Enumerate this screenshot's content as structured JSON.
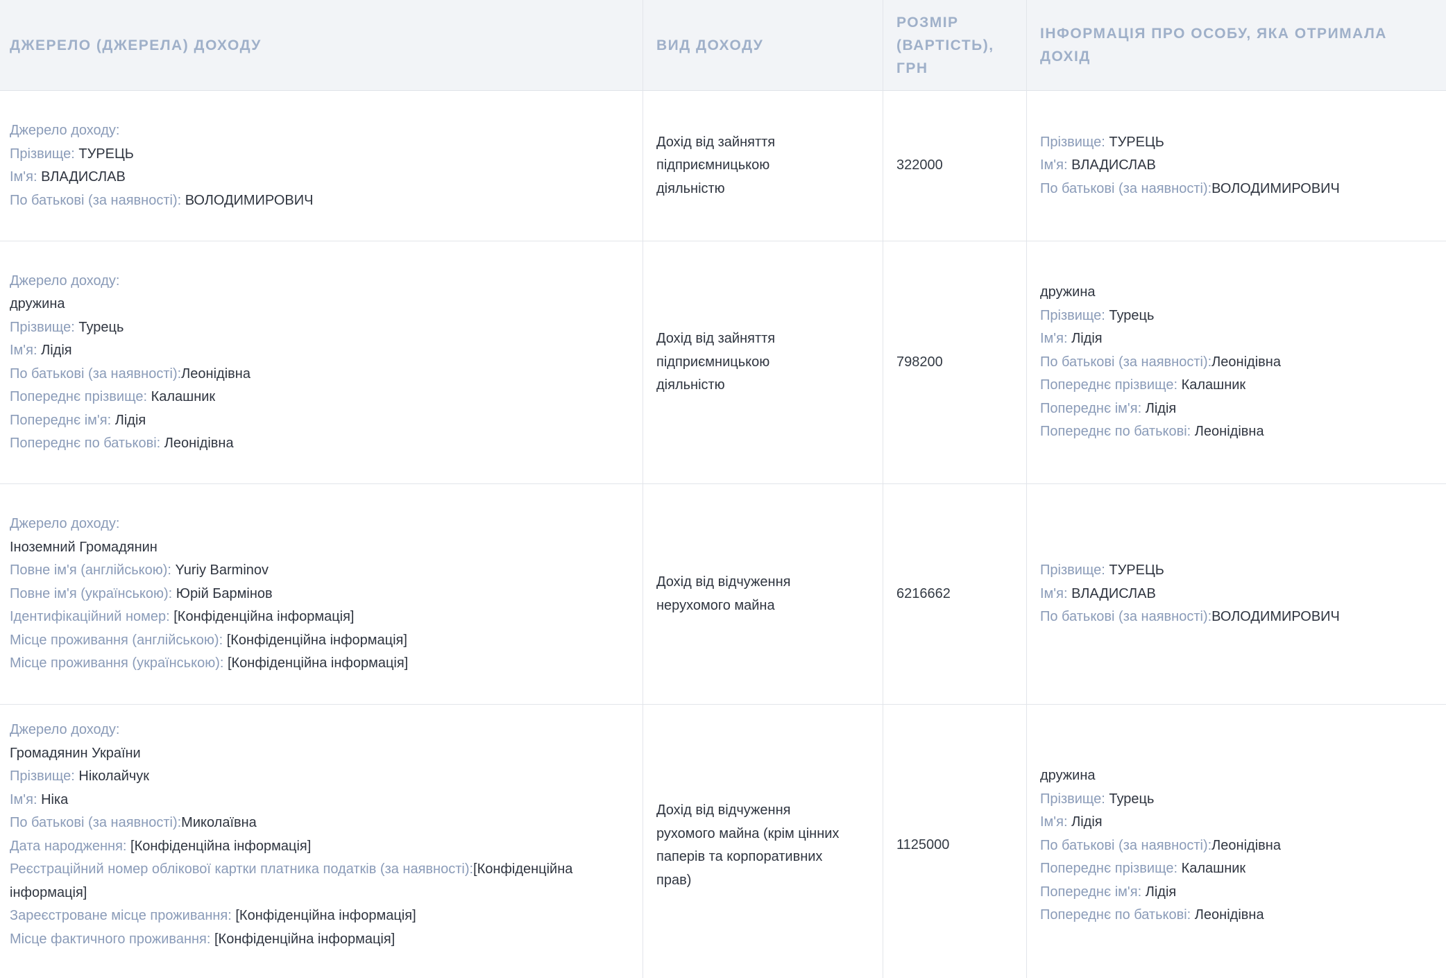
{
  "header": {
    "source": "ДЖЕРЕЛО (ДЖЕРЕЛА) ДОХОДУ",
    "type": "ВИД ДОХОДУ",
    "amount": "РОЗМІР (ВАРТІСТЬ), ГРН",
    "recipient": "ІНФОРМАЦІЯ ПРО ОСОБУ, ЯКА ОТРИМАЛА ДОХІД"
  },
  "rows": [
    {
      "source": [
        {
          "label": "Джерело доходу:",
          "value": ""
        },
        {
          "label": "Прізвище: ",
          "value": "ТУРЕЦЬ"
        },
        {
          "label": "Ім'я: ",
          "value": "ВЛАДИСЛАВ"
        },
        {
          "label": "По батькові (за наявності): ",
          "value": "ВОЛОДИМИРОВИЧ"
        }
      ],
      "type": [
        "Дохід від зайняття",
        "підприємницькою",
        "діяльністю"
      ],
      "amount": "322000",
      "recipient": [
        {
          "label": "Прізвище: ",
          "value": "ТУРЕЦЬ"
        },
        {
          "label": "Ім'я: ",
          "value": "ВЛАДИСЛАВ"
        },
        {
          "label": "По батькові (за наявності):",
          "value": "ВОЛОДИМИРОВИЧ"
        }
      ]
    },
    {
      "source": [
        {
          "label": "Джерело доходу:",
          "value": ""
        },
        {
          "label": "",
          "value": "дружина"
        },
        {
          "label": "Прізвище: ",
          "value": "Турець"
        },
        {
          "label": "Ім'я: ",
          "value": "Лідія"
        },
        {
          "label": "По батькові (за наявності):",
          "value": "Леонідівна"
        },
        {
          "label": "Попереднє прізвище: ",
          "value": "Калашник"
        },
        {
          "label": "Попереднє ім'я: ",
          "value": "Лідія"
        },
        {
          "label": "Попереднє по батькові: ",
          "value": "Леонідівна"
        }
      ],
      "type": [
        "Дохід від зайняття",
        "підприємницькою",
        "діяльністю"
      ],
      "amount": "798200",
      "recipient": [
        {
          "label": "",
          "value": "дружина"
        },
        {
          "label": "Прізвище: ",
          "value": "Турець"
        },
        {
          "label": "Ім'я: ",
          "value": "Лідія"
        },
        {
          "label": "По батькові (за наявності):",
          "value": "Леонідівна"
        },
        {
          "label": "Попереднє прізвище: ",
          "value": "Калашник"
        },
        {
          "label": "Попереднє ім'я: ",
          "value": "Лідія"
        },
        {
          "label": "Попереднє по батькові: ",
          "value": "Леонідівна"
        }
      ]
    },
    {
      "source": [
        {
          "label": "Джерело доходу:",
          "value": ""
        },
        {
          "label": "",
          "value": "Іноземний Громадянин"
        },
        {
          "label": "Повне ім'я (англійською): ",
          "value": "Yuriy Barminov"
        },
        {
          "label": "Повне ім'я (українською): ",
          "value": "Юрій Бармінов"
        },
        {
          "label": "Ідентифікаційний номер: ",
          "value": "[Конфіденційна інформація]"
        },
        {
          "label": "Місце проживання (англійською): ",
          "value": "[Конфіденційна інформація]"
        },
        {
          "label": "Місце проживання (українською): ",
          "value": "[Конфіденційна інформація]"
        }
      ],
      "type": [
        "Дохід від відчуження",
        "нерухомого майна"
      ],
      "amount": "6216662",
      "recipient": [
        {
          "label": "Прізвище: ",
          "value": "ТУРЕЦЬ"
        },
        {
          "label": "Ім'я: ",
          "value": "ВЛАДИСЛАВ"
        },
        {
          "label": "По батькові (за наявності):",
          "value": "ВОЛОДИМИРОВИЧ"
        }
      ]
    },
    {
      "source": [
        {
          "label": "Джерело доходу:",
          "value": ""
        },
        {
          "label": "",
          "value": "Громадянин України"
        },
        {
          "label": "Прізвище: ",
          "value": "Ніколайчук"
        },
        {
          "label": "Ім'я: ",
          "value": "Ніка"
        },
        {
          "label": "По батькові (за наявності):",
          "value": "Миколаївна"
        },
        {
          "label": "Дата народження: ",
          "value": "[Конфіденційна інформація]"
        },
        {
          "label": "Реєстраційний номер облікової картки платника податків (за наявності):",
          "value": "[Конфіденційна інформація]"
        },
        {
          "label": "Зареєстроване місце проживання: ",
          "value": "[Конфіденційна інформація]"
        },
        {
          "label": "Місце фактичного проживання: ",
          "value": "[Конфіденційна інформація]"
        }
      ],
      "type": [
        "Дохід від відчуження",
        "рухомого майна (крім цінних",
        "паперів та корпоративних",
        "прав)"
      ],
      "amount": "1125000",
      "recipient": [
        {
          "label": "",
          "value": "дружина"
        },
        {
          "label": "Прізвище: ",
          "value": "Турець"
        },
        {
          "label": "Ім'я: ",
          "value": "Лідія"
        },
        {
          "label": "По батькові (за наявності):",
          "value": "Леонідівна"
        },
        {
          "label": "Попереднє прізвище: ",
          "value": "Калашник"
        },
        {
          "label": "Попереднє ім'я: ",
          "value": "Лідія"
        },
        {
          "label": "Попереднє по батькові: ",
          "value": "Леонідівна"
        }
      ]
    }
  ]
}
